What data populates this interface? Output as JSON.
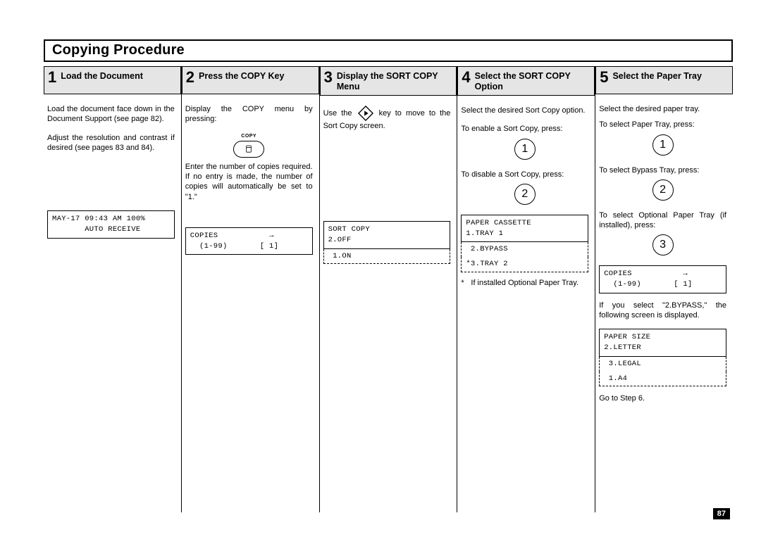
{
  "title": "Copying Procedure",
  "page_number": "87",
  "steps": [
    {
      "num": "1",
      "title": "Load the Document",
      "p1": "Load the document face down in the Document Support (see page 82).",
      "p2": "Adjust the resolution and contrast if desired (see pages 83 and 84).",
      "lcd1_line1": "MAY-17 09:43 AM 100%",
      "lcd1_line2": "       AUTO RECEIVE"
    },
    {
      "num": "2",
      "title": "Press the COPY Key",
      "p1": "Display the COPY menu by pressing:",
      "key_label": "COPY",
      "p2": "Enter the number of copies required. If no entry is made, the number of copies will automatically be set to \"1.\"",
      "lcd1_line1": "COPIES           →",
      "lcd1_line2": "  (1-99)       [ 1]"
    },
    {
      "num": "3",
      "title": "Display the SORT COPY Menu",
      "run_pre": "Use the ",
      "run_post": " key to move to the Sort Copy screen.",
      "lcd1_line1": "SORT COPY",
      "lcd1_line2": "2.OFF",
      "lcd1_ext1": " 1.ON"
    },
    {
      "num": "4",
      "title": "Select the SORT COPY Option",
      "p1": "Select the desired Sort Copy option.",
      "p2": "To enable a Sort Copy, press:",
      "btn1": "1",
      "p3": "To disable a Sort Copy, press:",
      "btn2": "2",
      "lcd1_line1": "PAPER CASSETTE",
      "lcd1_line2": "1.TRAY 1",
      "lcd1_ext1": " 2.BYPASS",
      "lcd1_ext2": "*3.TRAY 2",
      "note_ast": "*",
      "note": "If installed Optional Paper Tray."
    },
    {
      "num": "5",
      "title": "Select the Paper Tray",
      "p1": "Select the desired paper tray.",
      "p2": "To select Paper Tray, press:",
      "btn1": "1",
      "p3": "To select Bypass Tray, press:",
      "btn2": "2",
      "p4": "To select Optional Paper Tray (if installed), press:",
      "btn3": "3",
      "lcd1_line1": "COPIES           →",
      "lcd1_line2": "  (1-99)       [ 1]",
      "p5": "If you select \"2.BYPASS,\" the following screen is displayed.",
      "lcd2_line1": "PAPER SIZE",
      "lcd2_line2": "2.LETTER",
      "lcd2_ext1": " 3.LEGAL",
      "lcd2_ext2": " 1.A4",
      "p6": "Go to Step 6."
    }
  ]
}
